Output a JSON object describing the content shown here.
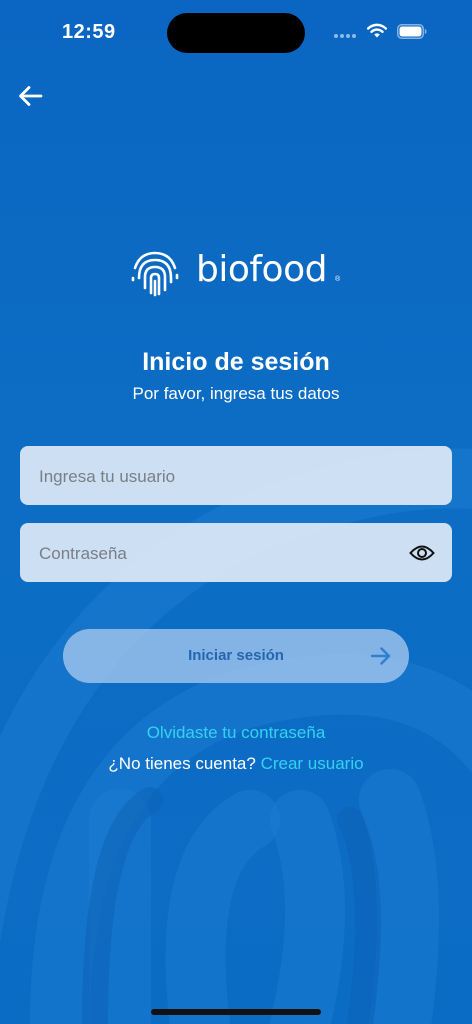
{
  "status_bar": {
    "time": "12:59"
  },
  "brand": {
    "name": "biofood",
    "registered_mark": "®"
  },
  "header": {
    "title": "Inicio de sesión",
    "subtitle": "Por favor, ingresa tus datos"
  },
  "form": {
    "username": {
      "value": "",
      "placeholder": "Ingresa tu usuario"
    },
    "password": {
      "value": "",
      "placeholder": "Contraseña"
    },
    "submit_label": "Iniciar sesión"
  },
  "links": {
    "forgot_password": "Olvidaste tu contraseña",
    "no_account_prompt": "¿No tienes cuenta?",
    "create_user": "Crear usuario"
  },
  "icons": {
    "back": "arrow-left-icon",
    "visibility": "eye-icon",
    "submit": "arrow-right-icon",
    "logo": "fingerprint-icon"
  },
  "colors": {
    "background": "#0d6dc4",
    "link": "#33d3f0",
    "button": "#a7c8ee",
    "button_text": "#2566b0"
  }
}
